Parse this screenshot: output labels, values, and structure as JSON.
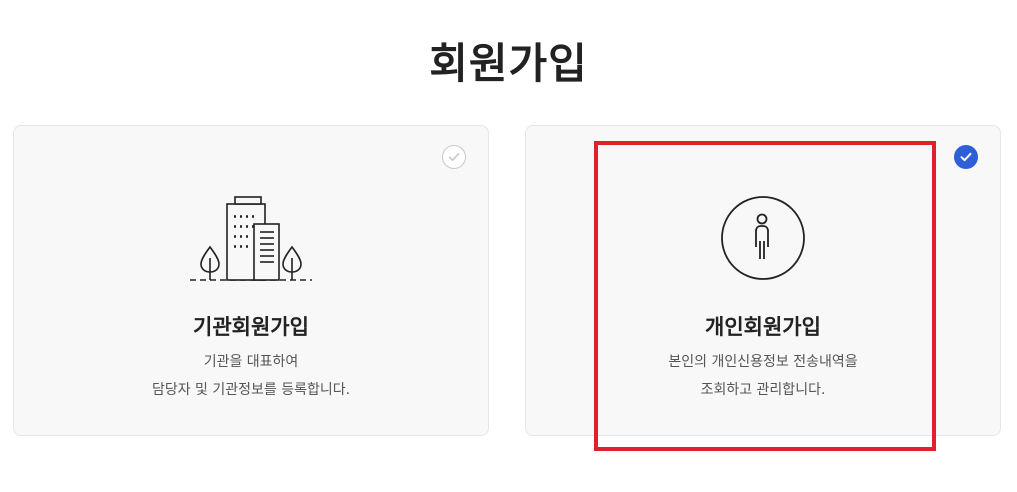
{
  "page": {
    "title": "회원가입"
  },
  "cards": [
    {
      "id": "org",
      "title": "기관회원가입",
      "desc_line1": "기관을 대표하여",
      "desc_line2": "담당자 및 기관정보를 등록합니다.",
      "selected": false,
      "icon": "building-icon"
    },
    {
      "id": "personal",
      "title": "개인회원가입",
      "desc_line1": "본인의 개인신용정보 전송내역을",
      "desc_line2": "조회하고 관리합니다.",
      "selected": true,
      "icon": "person-icon"
    }
  ],
  "colors": {
    "accent": "#2c5fd8",
    "highlight": "#e0202a",
    "card_bg": "#f8f8f8"
  }
}
